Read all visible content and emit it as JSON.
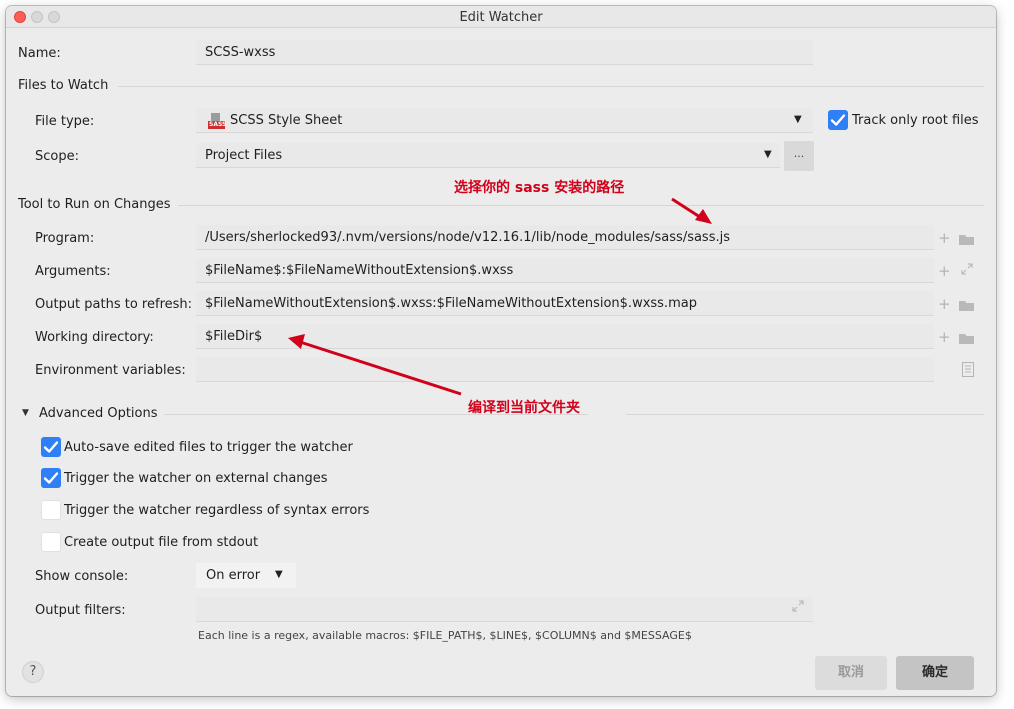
{
  "window": {
    "title": "Edit Watcher"
  },
  "name": {
    "label": "Name:",
    "value": "SCSS-wxss"
  },
  "files_section": {
    "title": "Files to Watch"
  },
  "file_type": {
    "label": "File type:",
    "icon_text": "SASS",
    "value": "SCSS Style Sheet",
    "arrow": "▼"
  },
  "track_root": {
    "label": "Track only root files",
    "checked": true
  },
  "scope": {
    "label": "Scope:",
    "value": "Project Files",
    "arrow": "▼",
    "browse": "..."
  },
  "tool_section": {
    "title": "Tool to Run on Changes"
  },
  "program": {
    "label": "Program:",
    "value": "/Users/sherlocked93/.nvm/versions/node/v12.16.1/lib/node_modules/sass/sass.js"
  },
  "arguments": {
    "label": "Arguments:",
    "value": "$FileName$:$FileNameWithoutExtension$.wxss"
  },
  "output_paths": {
    "label": "Output paths to refresh:",
    "value": "$FileNameWithoutExtension$.wxss:$FileNameWithoutExtension$.wxss.map"
  },
  "working_dir": {
    "label": "Working directory:",
    "value": "$FileDir$"
  },
  "env_vars": {
    "label": "Environment variables:",
    "value": ""
  },
  "advanced": {
    "title": "Advanced Options",
    "toggle": "▼",
    "options": [
      {
        "label": "Auto-save edited files to trigger the watcher",
        "checked": true
      },
      {
        "label": "Trigger the watcher on external changes",
        "checked": true
      },
      {
        "label": "Trigger the watcher regardless of syntax errors",
        "checked": false
      },
      {
        "label": "Create output file from stdout",
        "checked": false
      }
    ]
  },
  "show_console": {
    "label": "Show console:",
    "value": "On error",
    "arrow": "▼"
  },
  "output_filters": {
    "label": "Output filters:",
    "value": "",
    "hint": "Each line is a regex, available macros: $FILE_PATH$, $LINE$, $COLUMN$ and $MESSAGE$"
  },
  "annotations": {
    "sass_path": "选择你的 sass 安装的路径",
    "compile_dir": "编译到当前文件夹"
  },
  "footer": {
    "help": "?",
    "cancel": "取消",
    "ok": "确定"
  },
  "colors": {
    "accent": "#2f7ff6",
    "annotation": "#d0021b",
    "close": "#fe5f57"
  },
  "icons": {
    "plus": "plus-icon",
    "folder": "folder-icon",
    "expand": "expand-icon",
    "document": "document-icon"
  }
}
